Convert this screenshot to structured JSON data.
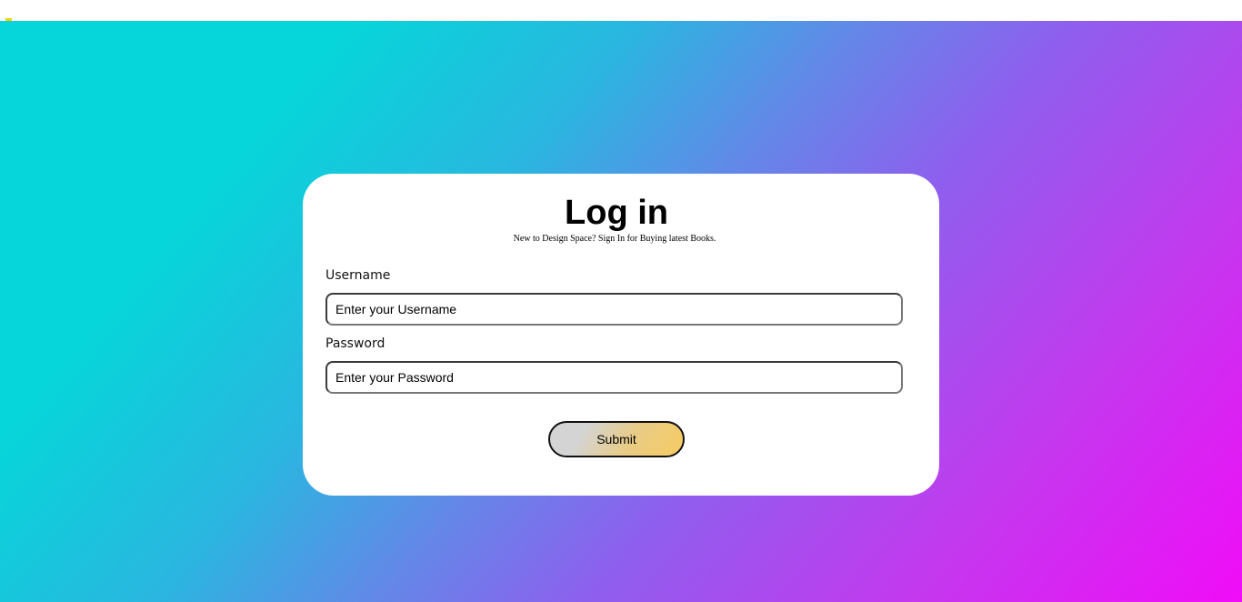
{
  "login": {
    "title": "Log in",
    "subtitle": "New to Design Space? Sign In for Buying latest Books.",
    "username_label": "Username",
    "username_placeholder": "Enter your Username",
    "password_label": "Password",
    "password_placeholder": "Enter your Password",
    "submit_label": "Submit"
  },
  "colors": {
    "gradient_start": "#06d6d9",
    "gradient_mid": "#8e5fee",
    "gradient_end": "#f10cf8",
    "card_background": "#ffffff",
    "button_gradient_start": "#d4d4d4",
    "button_gradient_end": "#f7cb62",
    "corner_mark": "#f2d200"
  }
}
